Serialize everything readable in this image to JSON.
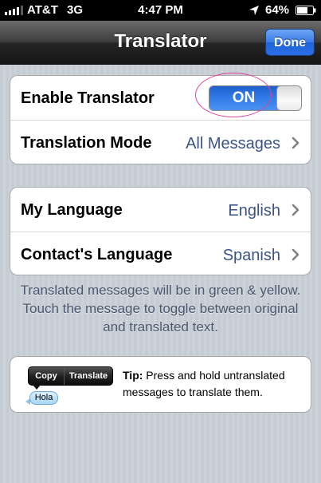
{
  "status_bar": {
    "carrier": "AT&T",
    "network": "3G",
    "time": "4:47 PM",
    "battery_percent": "64%"
  },
  "nav_bar": {
    "title": "Translator",
    "done_label": "Done"
  },
  "settings": {
    "enable_translator": {
      "label": "Enable Translator",
      "toggle_label": "ON"
    },
    "translation_mode": {
      "label": "Translation Mode",
      "value": "All Messages"
    },
    "my_language": {
      "label": "My Language",
      "value": "English"
    },
    "contacts_language": {
      "label": "Contact's Language",
      "value": "Spanish"
    }
  },
  "footer_note": "Translated messages will be in green & yellow. Touch the message to toggle between original and translated text.",
  "tip": {
    "menu_copy": "Copy",
    "menu_translate": "Translate",
    "bubble_text": "Hola",
    "label": "Tip:",
    "text": " Press and hold untranslated messages to translate them."
  },
  "colors": {
    "accent_blue": "#2f7ae8",
    "value_text": "#3b5485",
    "highlight_ring": "#e0409a"
  }
}
